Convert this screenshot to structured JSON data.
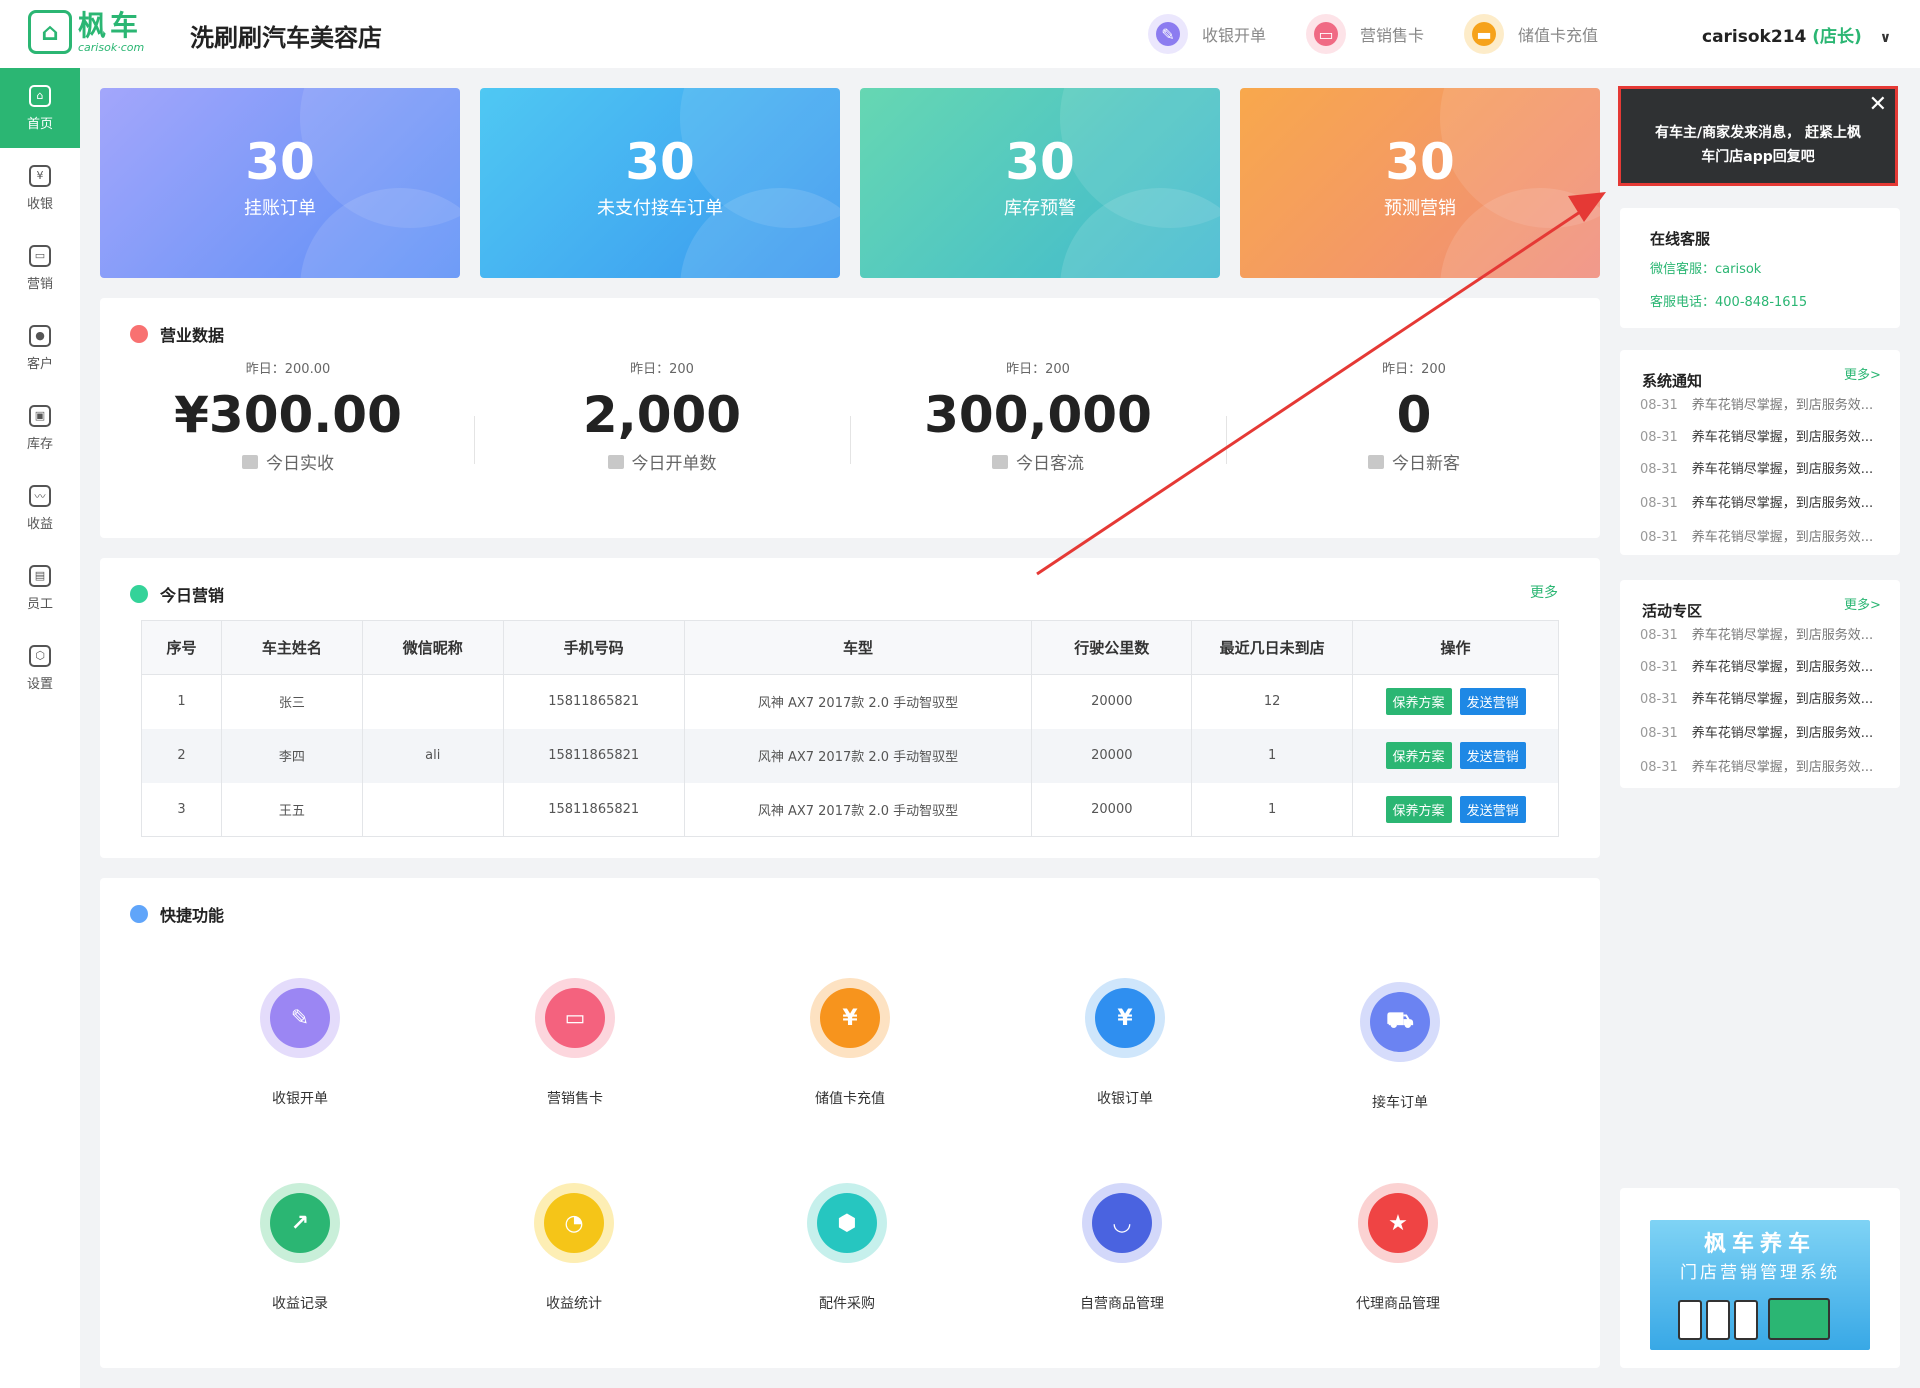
{
  "header": {
    "logo_cn": "枫车",
    "logo_en": "carisok·com",
    "store_name": "洗刷刷汽车美容店",
    "actions": [
      {
        "label": "收银开单",
        "icon": "cash-register-icon",
        "color": "#8c7cf0"
      },
      {
        "label": "营销售卡",
        "icon": "card-icon",
        "color": "#f06a84"
      },
      {
        "label": "储值卡充值",
        "icon": "wallet-icon",
        "color": "#f6a21a"
      }
    ],
    "user_name": "carisok214",
    "user_role": "(店长)"
  },
  "sidebar": {
    "items": [
      {
        "label": "首页",
        "icon": "home-icon",
        "glyph": "⌂"
      },
      {
        "label": "收银",
        "icon": "cashier-icon",
        "glyph": "¥"
      },
      {
        "label": "营销",
        "icon": "ticket-icon",
        "glyph": "▭"
      },
      {
        "label": "客户",
        "icon": "customer-icon",
        "glyph": "●"
      },
      {
        "label": "库存",
        "icon": "inventory-icon",
        "glyph": "▣"
      },
      {
        "label": "收益",
        "icon": "revenue-chart-icon",
        "glyph": "〰"
      },
      {
        "label": "员工",
        "icon": "staff-icon",
        "glyph": "▤"
      },
      {
        "label": "设置",
        "icon": "settings-icon",
        "glyph": "⬡"
      }
    ]
  },
  "stats": [
    {
      "value": "30",
      "label": "挂账订单",
      "color_from": "#9fa8fb",
      "color_to": "#5a8ff5"
    },
    {
      "value": "30",
      "label": "未支付接车订单",
      "color_from": "#4bc4f2",
      "color_to": "#3a98f0"
    },
    {
      "value": "30",
      "label": "库存预警",
      "color_from": "#62d6b4",
      "color_to": "#3fb9cf"
    },
    {
      "value": "30",
      "label": "预测营销",
      "color_from": "#f8a64e",
      "color_to": "#f0897a"
    }
  ],
  "business": {
    "title": "营业数据",
    "items": [
      {
        "yesterday": "昨日：200.00",
        "value": "¥300.00",
        "label": "今日实收"
      },
      {
        "yesterday": "昨日：200",
        "value": "2,000",
        "label": "今日开单数"
      },
      {
        "yesterday": "昨日：200",
        "value": "300,000",
        "label": "今日客流"
      },
      {
        "yesterday": "昨日：200",
        "value": "0",
        "label": "今日新客"
      }
    ]
  },
  "marketing": {
    "title": "今日营销",
    "more": "更多",
    "columns": [
      "序号",
      "车主姓名",
      "微信昵称",
      "手机号码",
      "车型",
      "行驶公里数",
      "最近几日未到店",
      "操作"
    ],
    "rows": [
      {
        "no": "1",
        "name": "张三",
        "wechat": "",
        "phone": "15811865821",
        "car": "风神 AX7 2017款 2.0 手动智驭型",
        "km": "20000",
        "days": "12"
      },
      {
        "no": "2",
        "name": "李四",
        "wechat": "ali",
        "phone": "15811865821",
        "car": "风神 AX7 2017款 2.0 手动智驭型",
        "km": "20000",
        "days": "1"
      },
      {
        "no": "3",
        "name": "王五",
        "wechat": "",
        "phone": "15811865821",
        "car": "风神 AX7 2017款 2.0 手动智驭型",
        "km": "20000",
        "days": "1"
      }
    ],
    "btn_plan": "保养方案",
    "btn_send": "发送营销"
  },
  "quick": {
    "title": "快捷功能",
    "items": [
      {
        "label": "收银开单",
        "icon": "cash-register-icon",
        "glyph": "✎",
        "ring": "#e4dcfb",
        "core": "#9b86f3"
      },
      {
        "label": "营销售卡",
        "icon": "card-icon",
        "glyph": "▭",
        "ring": "#fcd6dd",
        "core": "#f4627e"
      },
      {
        "label": "储值卡充值",
        "icon": "wallet-icon",
        "glyph": "¥",
        "ring": "#fde2c2",
        "core": "#f7941d"
      },
      {
        "label": "收银订单",
        "icon": "cashier-monitor-icon",
        "glyph": "¥",
        "ring": "#cfe6fb",
        "core": "#2f8ff0"
      },
      {
        "label": "接车订单",
        "icon": "car-icon",
        "glyph": "⛟",
        "ring": "#d6dcfb",
        "core": "#6b83f2"
      },
      {
        "label": "收益记录",
        "icon": "growth-chart-icon",
        "glyph": "↗",
        "ring": "#c9efd9",
        "core": "#2bb673"
      },
      {
        "label": "收益统计",
        "icon": "pie-chart-icon",
        "glyph": "◔",
        "ring": "#fdeeb4",
        "core": "#f5c518"
      },
      {
        "label": "配件采购",
        "icon": "hex-nut-icon",
        "glyph": "⬢",
        "ring": "#c6f0ec",
        "core": "#26c6c0"
      },
      {
        "label": "自营商品管理",
        "icon": "shopping-bag-icon",
        "glyph": "◡",
        "ring": "#d3d8fa",
        "core": "#4a63e0"
      },
      {
        "label": "代理商品管理",
        "icon": "star-badge-icon",
        "glyph": "★",
        "ring": "#fbd2d2",
        "core": "#ef4444"
      }
    ]
  },
  "toast": {
    "line1": "有车主/商家发来消息， 赶紧上枫",
    "line2": "车门店app回复吧",
    "close": "✕"
  },
  "service": {
    "title": "在线客服",
    "wechat": "微信客服：carisok",
    "phone": "客服电话：400-848-1615"
  },
  "system_notice": {
    "title": "系统通知",
    "more": "更多>",
    "items": [
      {
        "date": "08-31",
        "text": "养车花销尽掌握，到店服务效..."
      },
      {
        "date": "08-31",
        "text": "养车花销尽掌握，到店服务效..."
      },
      {
        "date": "08-31",
        "text": "养车花销尽掌握，到店服务效..."
      },
      {
        "date": "08-31",
        "text": "养车花销尽掌握，到店服务效..."
      },
      {
        "date": "08-31",
        "text": "养车花销尽掌握，到店服务效..."
      }
    ]
  },
  "activity": {
    "title": "活动专区",
    "more": "更多>",
    "items": [
      {
        "date": "08-31",
        "text": "养车花销尽掌握，到店服务效..."
      },
      {
        "date": "08-31",
        "text": "养车花销尽掌握，到店服务效..."
      },
      {
        "date": "08-31",
        "text": "养车花销尽掌握，到店服务效..."
      },
      {
        "date": "08-31",
        "text": "养车花销尽掌握，到店服务效..."
      },
      {
        "date": "08-31",
        "text": "养车花销尽掌握，到店服务效..."
      }
    ]
  },
  "promo": {
    "line1": "枫车养车",
    "line2": "门店营销管理系统"
  }
}
